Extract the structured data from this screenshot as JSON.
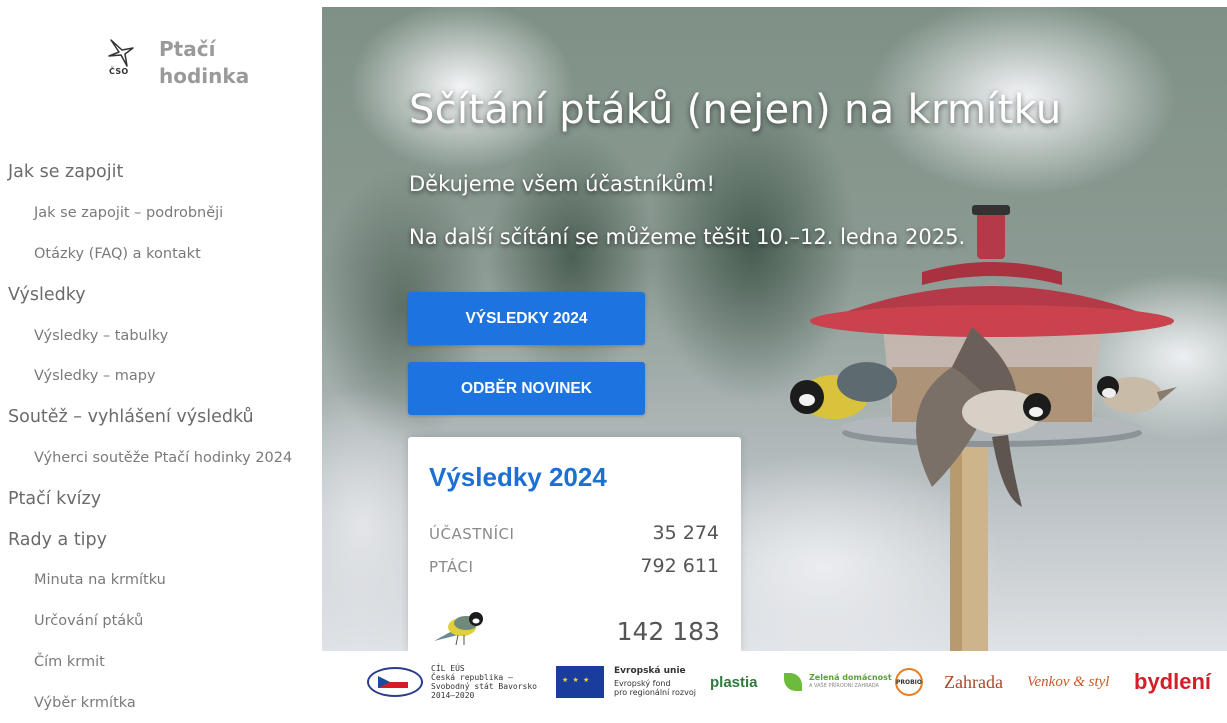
{
  "logo": {
    "abbr": "ČSO",
    "name_line1": "Ptačí",
    "name_line2": "hodinka"
  },
  "nav": {
    "items": [
      {
        "label": "Jak se zapojit",
        "level": 1
      },
      {
        "label": "Jak se zapojit – podrobněji",
        "level": 2
      },
      {
        "label": "Otázky (FAQ) a kontakt",
        "level": 2
      },
      {
        "label": "Výsledky",
        "level": 1
      },
      {
        "label": "Výsledky – tabulky",
        "level": 2
      },
      {
        "label": "Výsledky – mapy",
        "level": 2
      },
      {
        "label": "Soutěž – vyhlášení výsledků",
        "level": 1
      },
      {
        "label": "Výherci soutěže Ptačí hodinky 2024",
        "level": 2
      },
      {
        "label": "Ptačí kvízy",
        "level": 1
      },
      {
        "label": "Rady a tipy",
        "level": 1
      },
      {
        "label": "Minuta na krmítku",
        "level": 2
      },
      {
        "label": "Určování ptáků",
        "level": 2
      },
      {
        "label": "Čím krmit",
        "level": 2
      },
      {
        "label": "Výběr krmítka",
        "level": 2
      }
    ]
  },
  "hero": {
    "title": "Sčítání ptáků (nejen) na krmítku",
    "subtitle1": "Děkujeme všem účastníkům!",
    "subtitle2": "Na další sčítání se můžeme těšit 10.–12. ledna 2025.",
    "button_results": "VÝSLEDKY 2024",
    "button_newsletter": "ODBĚR NOVINEK"
  },
  "results_card": {
    "title": "Výsledky 2024",
    "participants_label": "ÚČASTNÍCI",
    "participants_value": "35 274",
    "birds_label": "PTÁCI",
    "birds_value": "792 611",
    "top_species_count": "142 183"
  },
  "sponsors": {
    "cil_title": "CÍL EÚS",
    "cil_line1": "Česká republika –",
    "cil_line2": "Svobodný stát Bavorsko",
    "cil_line3": "2014–2020",
    "eu_title": "Evropská unie",
    "eu_line1": "Evropský fond",
    "eu_line2": "pro regionální rozvoj",
    "plastia": "plastia",
    "zelena1": "Zelená domácnost",
    "zelena2": "A VAŠE PŘÍRODNÍ ZAHRADA",
    "probio": "PROBIO",
    "zahrada": "Zahrada",
    "venkov": "Venkov & styl",
    "bydleni": "bydlení"
  },
  "colors": {
    "accent": "#1d74e0",
    "card_title": "#1c6fd3",
    "feeder_red": "#c9424e"
  }
}
